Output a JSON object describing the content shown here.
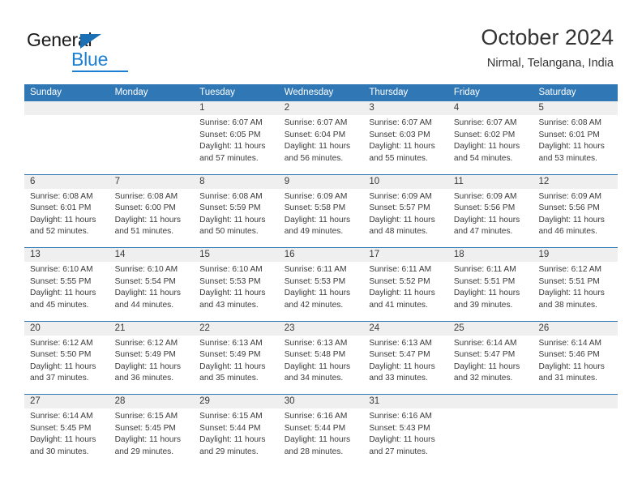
{
  "brand": {
    "name_part1": "General",
    "name_part2": "Blue"
  },
  "header": {
    "title": "October 2024",
    "subtitle": "Nirmal, Telangana, India"
  },
  "weekdays": [
    "Sunday",
    "Monday",
    "Tuesday",
    "Wednesday",
    "Thursday",
    "Friday",
    "Saturday"
  ],
  "colors": {
    "header_blue": "#3077b5",
    "brand_blue": "#1b7fd4",
    "day_band_gray": "#efefef",
    "text": "#3a3a3a"
  },
  "weeks": [
    [
      {
        "day": "",
        "sunrise": "",
        "sunset": "",
        "daylight1": "",
        "daylight2": ""
      },
      {
        "day": "",
        "sunrise": "",
        "sunset": "",
        "daylight1": "",
        "daylight2": ""
      },
      {
        "day": "1",
        "sunrise": "Sunrise: 6:07 AM",
        "sunset": "Sunset: 6:05 PM",
        "daylight1": "Daylight: 11 hours",
        "daylight2": "and 57 minutes."
      },
      {
        "day": "2",
        "sunrise": "Sunrise: 6:07 AM",
        "sunset": "Sunset: 6:04 PM",
        "daylight1": "Daylight: 11 hours",
        "daylight2": "and 56 minutes."
      },
      {
        "day": "3",
        "sunrise": "Sunrise: 6:07 AM",
        "sunset": "Sunset: 6:03 PM",
        "daylight1": "Daylight: 11 hours",
        "daylight2": "and 55 minutes."
      },
      {
        "day": "4",
        "sunrise": "Sunrise: 6:07 AM",
        "sunset": "Sunset: 6:02 PM",
        "daylight1": "Daylight: 11 hours",
        "daylight2": "and 54 minutes."
      },
      {
        "day": "5",
        "sunrise": "Sunrise: 6:08 AM",
        "sunset": "Sunset: 6:01 PM",
        "daylight1": "Daylight: 11 hours",
        "daylight2": "and 53 minutes."
      }
    ],
    [
      {
        "day": "6",
        "sunrise": "Sunrise: 6:08 AM",
        "sunset": "Sunset: 6:01 PM",
        "daylight1": "Daylight: 11 hours",
        "daylight2": "and 52 minutes."
      },
      {
        "day": "7",
        "sunrise": "Sunrise: 6:08 AM",
        "sunset": "Sunset: 6:00 PM",
        "daylight1": "Daylight: 11 hours",
        "daylight2": "and 51 minutes."
      },
      {
        "day": "8",
        "sunrise": "Sunrise: 6:08 AM",
        "sunset": "Sunset: 5:59 PM",
        "daylight1": "Daylight: 11 hours",
        "daylight2": "and 50 minutes."
      },
      {
        "day": "9",
        "sunrise": "Sunrise: 6:09 AM",
        "sunset": "Sunset: 5:58 PM",
        "daylight1": "Daylight: 11 hours",
        "daylight2": "and 49 minutes."
      },
      {
        "day": "10",
        "sunrise": "Sunrise: 6:09 AM",
        "sunset": "Sunset: 5:57 PM",
        "daylight1": "Daylight: 11 hours",
        "daylight2": "and 48 minutes."
      },
      {
        "day": "11",
        "sunrise": "Sunrise: 6:09 AM",
        "sunset": "Sunset: 5:56 PM",
        "daylight1": "Daylight: 11 hours",
        "daylight2": "and 47 minutes."
      },
      {
        "day": "12",
        "sunrise": "Sunrise: 6:09 AM",
        "sunset": "Sunset: 5:56 PM",
        "daylight1": "Daylight: 11 hours",
        "daylight2": "and 46 minutes."
      }
    ],
    [
      {
        "day": "13",
        "sunrise": "Sunrise: 6:10 AM",
        "sunset": "Sunset: 5:55 PM",
        "daylight1": "Daylight: 11 hours",
        "daylight2": "and 45 minutes."
      },
      {
        "day": "14",
        "sunrise": "Sunrise: 6:10 AM",
        "sunset": "Sunset: 5:54 PM",
        "daylight1": "Daylight: 11 hours",
        "daylight2": "and 44 minutes."
      },
      {
        "day": "15",
        "sunrise": "Sunrise: 6:10 AM",
        "sunset": "Sunset: 5:53 PM",
        "daylight1": "Daylight: 11 hours",
        "daylight2": "and 43 minutes."
      },
      {
        "day": "16",
        "sunrise": "Sunrise: 6:11 AM",
        "sunset": "Sunset: 5:53 PM",
        "daylight1": "Daylight: 11 hours",
        "daylight2": "and 42 minutes."
      },
      {
        "day": "17",
        "sunrise": "Sunrise: 6:11 AM",
        "sunset": "Sunset: 5:52 PM",
        "daylight1": "Daylight: 11 hours",
        "daylight2": "and 41 minutes."
      },
      {
        "day": "18",
        "sunrise": "Sunrise: 6:11 AM",
        "sunset": "Sunset: 5:51 PM",
        "daylight1": "Daylight: 11 hours",
        "daylight2": "and 39 minutes."
      },
      {
        "day": "19",
        "sunrise": "Sunrise: 6:12 AM",
        "sunset": "Sunset: 5:51 PM",
        "daylight1": "Daylight: 11 hours",
        "daylight2": "and 38 minutes."
      }
    ],
    [
      {
        "day": "20",
        "sunrise": "Sunrise: 6:12 AM",
        "sunset": "Sunset: 5:50 PM",
        "daylight1": "Daylight: 11 hours",
        "daylight2": "and 37 minutes."
      },
      {
        "day": "21",
        "sunrise": "Sunrise: 6:12 AM",
        "sunset": "Sunset: 5:49 PM",
        "daylight1": "Daylight: 11 hours",
        "daylight2": "and 36 minutes."
      },
      {
        "day": "22",
        "sunrise": "Sunrise: 6:13 AM",
        "sunset": "Sunset: 5:49 PM",
        "daylight1": "Daylight: 11 hours",
        "daylight2": "and 35 minutes."
      },
      {
        "day": "23",
        "sunrise": "Sunrise: 6:13 AM",
        "sunset": "Sunset: 5:48 PM",
        "daylight1": "Daylight: 11 hours",
        "daylight2": "and 34 minutes."
      },
      {
        "day": "24",
        "sunrise": "Sunrise: 6:13 AM",
        "sunset": "Sunset: 5:47 PM",
        "daylight1": "Daylight: 11 hours",
        "daylight2": "and 33 minutes."
      },
      {
        "day": "25",
        "sunrise": "Sunrise: 6:14 AM",
        "sunset": "Sunset: 5:47 PM",
        "daylight1": "Daylight: 11 hours",
        "daylight2": "and 32 minutes."
      },
      {
        "day": "26",
        "sunrise": "Sunrise: 6:14 AM",
        "sunset": "Sunset: 5:46 PM",
        "daylight1": "Daylight: 11 hours",
        "daylight2": "and 31 minutes."
      }
    ],
    [
      {
        "day": "27",
        "sunrise": "Sunrise: 6:14 AM",
        "sunset": "Sunset: 5:45 PM",
        "daylight1": "Daylight: 11 hours",
        "daylight2": "and 30 minutes."
      },
      {
        "day": "28",
        "sunrise": "Sunrise: 6:15 AM",
        "sunset": "Sunset: 5:45 PM",
        "daylight1": "Daylight: 11 hours",
        "daylight2": "and 29 minutes."
      },
      {
        "day": "29",
        "sunrise": "Sunrise: 6:15 AM",
        "sunset": "Sunset: 5:44 PM",
        "daylight1": "Daylight: 11 hours",
        "daylight2": "and 29 minutes."
      },
      {
        "day": "30",
        "sunrise": "Sunrise: 6:16 AM",
        "sunset": "Sunset: 5:44 PM",
        "daylight1": "Daylight: 11 hours",
        "daylight2": "and 28 minutes."
      },
      {
        "day": "31",
        "sunrise": "Sunrise: 6:16 AM",
        "sunset": "Sunset: 5:43 PM",
        "daylight1": "Daylight: 11 hours",
        "daylight2": "and 27 minutes."
      },
      {
        "day": "",
        "sunrise": "",
        "sunset": "",
        "daylight1": "",
        "daylight2": ""
      },
      {
        "day": "",
        "sunrise": "",
        "sunset": "",
        "daylight1": "",
        "daylight2": ""
      }
    ]
  ]
}
